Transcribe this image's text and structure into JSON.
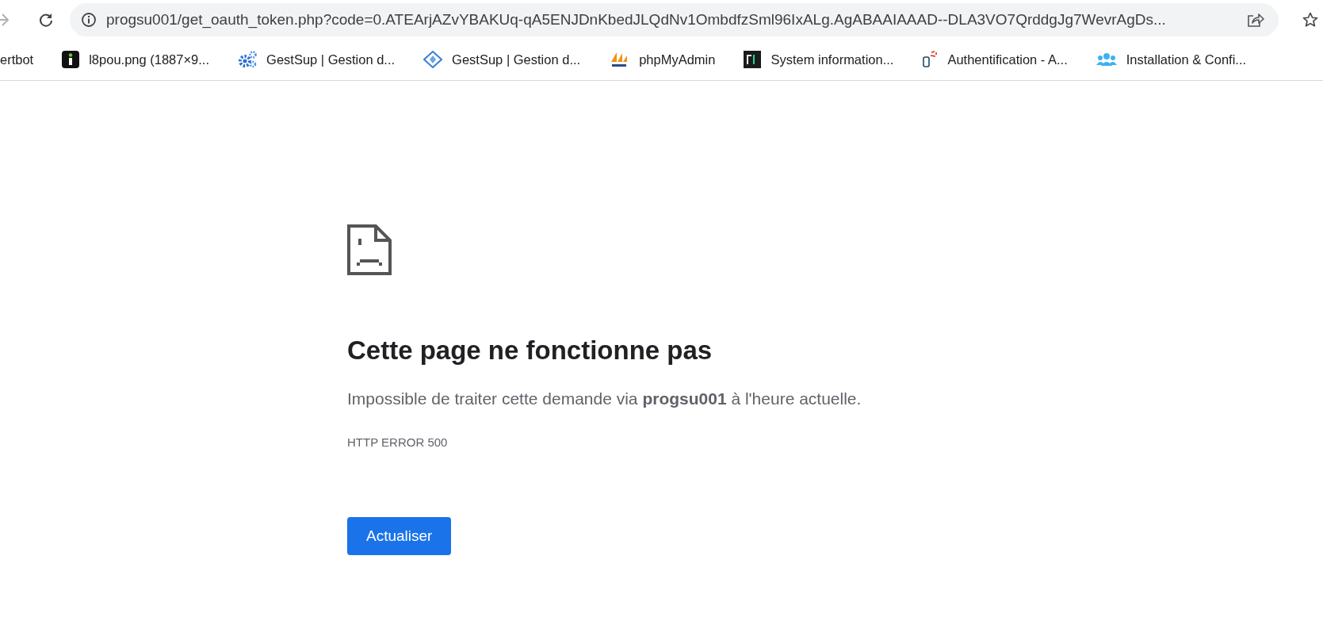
{
  "toolbar": {
    "forward": {
      "disabled": true
    },
    "url": "progsu001/get_oauth_token.php?code=0.ATEArjAZvYBAKUq-qA5ENJDnKbedJLQdNv1OmbdfzSml96IxALg.AgABAAIAAAD--DLA3VO7QrddgJg7WevrAgDs..."
  },
  "bookmarks": [
    {
      "label": "ertbot",
      "kind": "none"
    },
    {
      "label": "l8pou.png (1887×9...",
      "kind": "image"
    },
    {
      "label": "GestSup | Gestion d...",
      "kind": "gears"
    },
    {
      "label": "GestSup | Gestion d...",
      "kind": "diamond"
    },
    {
      "label": "phpMyAdmin",
      "kind": "sails"
    },
    {
      "label": "System information...",
      "kind": "terminal"
    },
    {
      "label": "Authentification - A...",
      "kind": "database"
    },
    {
      "label": "Installation & Confi...",
      "kind": "people"
    }
  ],
  "error": {
    "title": "Cette page ne fonctionne pas",
    "message": "Impossible de traiter cette demande via **progsu001** à l'heure actuelle.",
    "code": "HTTP ERROR 500",
    "button": "Actualiser"
  }
}
